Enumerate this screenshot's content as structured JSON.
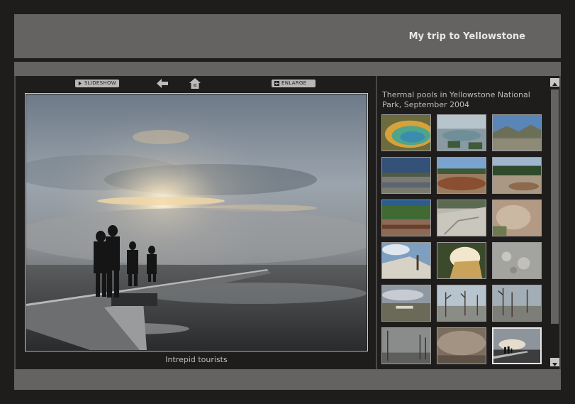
{
  "header": {
    "title": "My trip to Yellowstone"
  },
  "toolbar": {
    "slideshow_label": "SLIDESHOW",
    "enlarge_label": "ENLARGE",
    "back_icon": "left-arrow-icon",
    "home_icon": "home-icon"
  },
  "main": {
    "caption": "Intrepid tourists"
  },
  "gallery": {
    "title": "Thermal pools in Yellowstone National Park, September 2004",
    "thumbnails": [
      {
        "theme": "pool"
      },
      {
        "theme": "steam"
      },
      {
        "theme": "mountains"
      },
      {
        "theme": "lake"
      },
      {
        "theme": "redpool"
      },
      {
        "theme": "forest"
      },
      {
        "theme": "forestpool"
      },
      {
        "theme": "terrace"
      },
      {
        "theme": "mineral"
      },
      {
        "theme": "sky"
      },
      {
        "theme": "mound"
      },
      {
        "theme": "crust"
      },
      {
        "theme": "valley"
      },
      {
        "theme": "deadtrees"
      },
      {
        "theme": "deadtrees2"
      },
      {
        "theme": "fog"
      },
      {
        "theme": "mist"
      },
      {
        "theme": "sunset"
      }
    ],
    "selected_index": 17
  },
  "colors": {
    "panel": "#646362",
    "background": "#1f1d1b",
    "text": "#e6e6e6"
  }
}
